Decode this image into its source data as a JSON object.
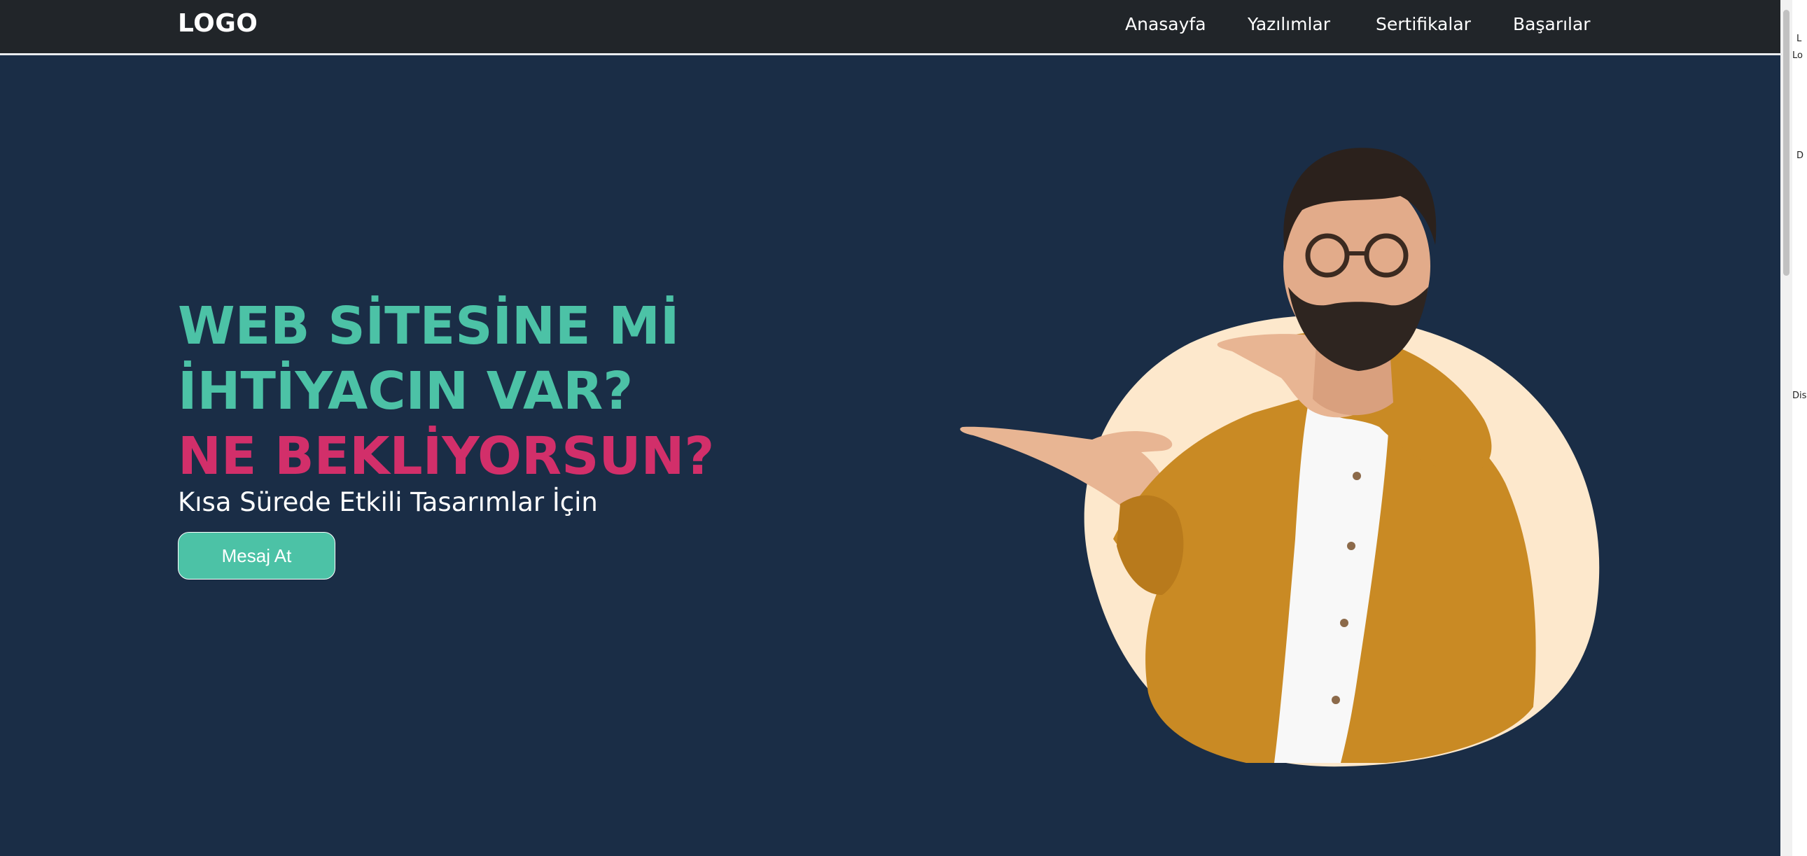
{
  "navbar": {
    "logo": "LOGO",
    "links": [
      "Anasayfa",
      "Yazılımlar",
      "Sertifikalar",
      "Başarılar"
    ]
  },
  "hero": {
    "title_line1": "WEB SİTESİNE Mİ",
    "title_line2": "İHTİYACIN VAR?",
    "title_line3": "NE BEKLİYORSUN?",
    "subtitle": "Kısa Sürede Etkili Tasarımlar İçin",
    "cta_label": "Mesaj At",
    "image_alt": "man-pointing-illustration"
  },
  "colors": {
    "background": "#1a2d46",
    "navbar": "#212529",
    "accent_teal": "#4cc2a6",
    "accent_pink": "#d22f6a",
    "blob": "#fde8cc",
    "jacket": "#c98a24"
  },
  "side_strip": {
    "fragments": [
      "L",
      "Lo",
      "D",
      "Dis"
    ]
  }
}
